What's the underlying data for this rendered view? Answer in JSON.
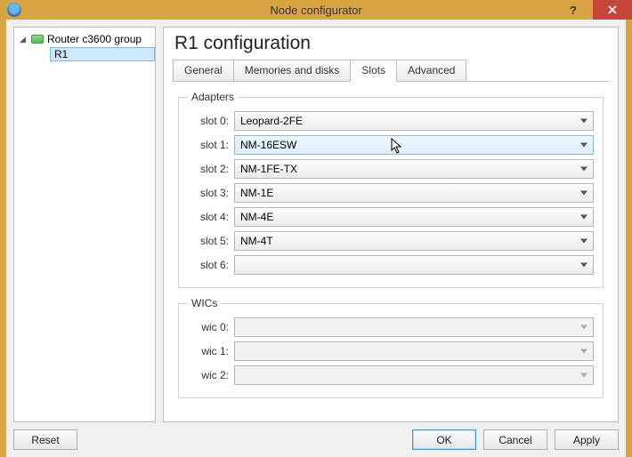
{
  "window": {
    "title": "Node configurator"
  },
  "tree": {
    "group_label": "Router c3600 group",
    "selected_child": "R1"
  },
  "heading": "R1 configuration",
  "tabs": {
    "t0": "General",
    "t1": "Memories and disks",
    "t2": "Slots",
    "t3": "Advanced"
  },
  "groups": {
    "adapters": "Adapters",
    "wics": "WICs"
  },
  "adapters": {
    "slot0": {
      "label": "slot 0:",
      "value": "Leopard-2FE"
    },
    "slot1": {
      "label": "slot 1:",
      "value": "NM-16ESW"
    },
    "slot2": {
      "label": "slot 2:",
      "value": "NM-1FE-TX"
    },
    "slot3": {
      "label": "slot 3:",
      "value": "NM-1E"
    },
    "slot4": {
      "label": "slot 4:",
      "value": "NM-4E"
    },
    "slot5": {
      "label": "slot 5:",
      "value": "NM-4T"
    },
    "slot6": {
      "label": "slot 6:",
      "value": ""
    }
  },
  "wics": {
    "wic0": {
      "label": "wic 0:",
      "value": ""
    },
    "wic1": {
      "label": "wic 1:",
      "value": ""
    },
    "wic2": {
      "label": "wic 2:",
      "value": ""
    }
  },
  "buttons": {
    "reset": "Reset",
    "ok": "OK",
    "cancel": "Cancel",
    "apply": "Apply"
  }
}
